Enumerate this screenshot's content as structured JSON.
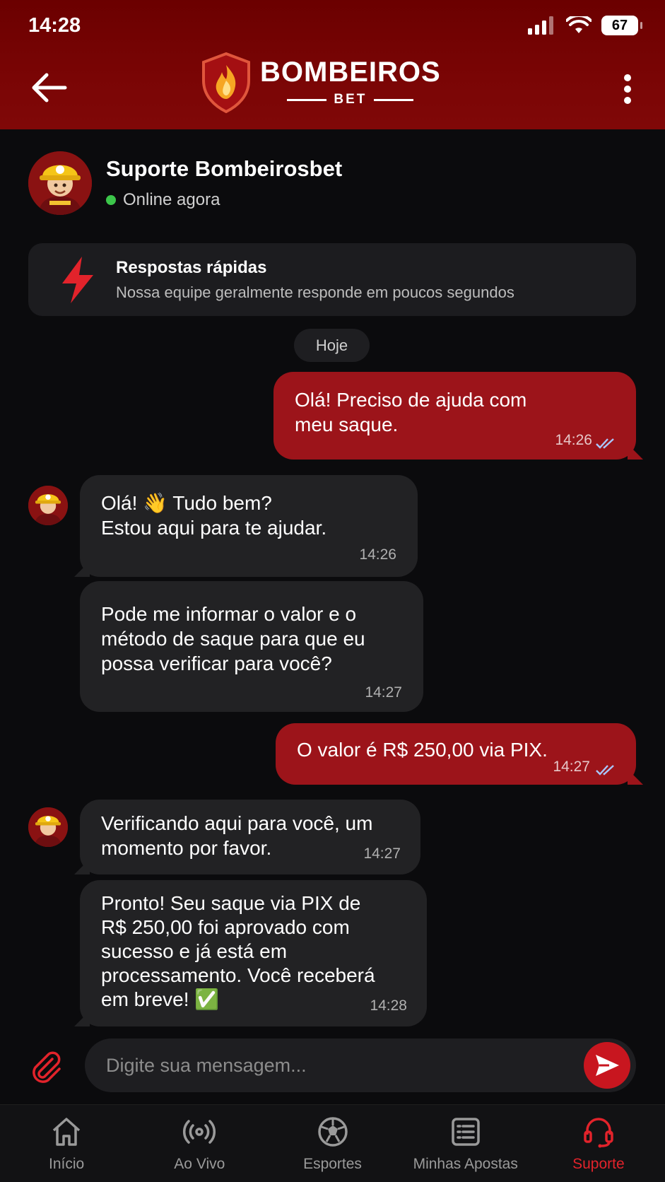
{
  "status_bar": {
    "time": "14:28",
    "battery": "67"
  },
  "header": {
    "brand": "BOMBEIROS",
    "brand_sub": "BET"
  },
  "agent": {
    "name": "Suporte Bombeirosbet",
    "status": "Online agora"
  },
  "quick_replies": {
    "title": "Respostas rápidas",
    "subtitle": "Nossa equipe geralmente responde em poucos segundos"
  },
  "day_label": "Hoje",
  "messages": [
    {
      "from": "user",
      "line1": "Olá! Preciso de ajuda com",
      "line2": "meu saque.",
      "time": "14:26"
    },
    {
      "from": "agent",
      "line1": "Olá! 👋 Tudo bem?",
      "line2": "Estou aqui para te ajudar.",
      "time": "14:26"
    },
    {
      "from": "agent",
      "line1": "Pode me informar o valor e o",
      "line2": "método de saque para que eu",
      "line3": "possa verificar para você?",
      "time": "14:27"
    },
    {
      "from": "user",
      "line1": "O valor é R$ 250,00 via PIX.",
      "time": "14:27"
    },
    {
      "from": "agent",
      "line1": "Verificando aqui para você, um",
      "line2": "momento por favor.",
      "time": "14:27"
    },
    {
      "from": "agent",
      "line1": "Pronto! Seu saque via PIX de",
      "line2": "R$ 250,00 foi aprovado com",
      "line3": "sucesso e já está em",
      "line4": "processamento. Você receberá",
      "line5": "em breve! ✅",
      "time": "14:28"
    }
  ],
  "composer": {
    "placeholder": "Digite sua mensagem..."
  },
  "nav": [
    {
      "label": "Início",
      "icon": "home-icon"
    },
    {
      "label": "Ao Vivo",
      "icon": "live-icon"
    },
    {
      "label": "Esportes",
      "icon": "soccer-ball-icon"
    },
    {
      "label": "Minhas Apostas",
      "icon": "bets-list-icon"
    },
    {
      "label": "Suporte",
      "icon": "headset-icon",
      "active": true
    }
  ],
  "colors": {
    "header": "#7a0505",
    "accent": "#c8161f",
    "outgoing": "#9c141a",
    "incoming": "#222224",
    "online": "#3cc64a"
  }
}
